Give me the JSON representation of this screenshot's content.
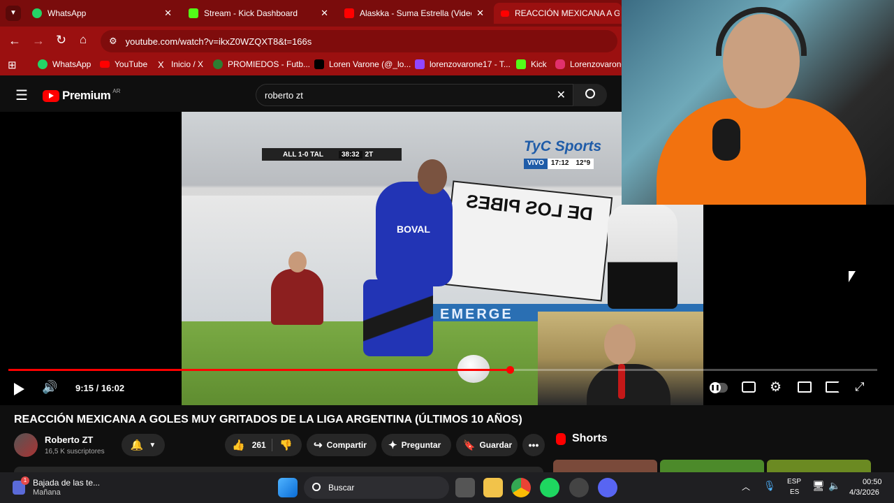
{
  "browser": {
    "tabs": [
      {
        "label": "WhatsApp",
        "color": "#25d366"
      },
      {
        "label": "Stream - Kick Dashboard",
        "color": "#53fc18"
      },
      {
        "label": "Alaskka - Suma Estrella (Video C",
        "color": "#ff0000"
      },
      {
        "label": "REACCIÓN MEXICANA A GO",
        "color": "#ff0000"
      }
    ],
    "url": "youtube.com/watch?v=ikxZ0WZQXT8&t=166s",
    "bookmarks": [
      {
        "label": "WhatsApp",
        "color": "#25d366"
      },
      {
        "label": "YouTube",
        "color": "#ff0000"
      },
      {
        "label": "Inicio / X",
        "color": "#000000"
      },
      {
        "label": "PROMIEDOS - Futb...",
        "color": "#2e7d32"
      },
      {
        "label": "Loren Varone (@_lo...",
        "color": "#000000"
      },
      {
        "label": "lorenzovarone17 - T...",
        "color": "#9146ff"
      },
      {
        "label": "Kick",
        "color": "#53fc18"
      },
      {
        "label": "Lorenzovarone",
        "color": "#e1306c"
      }
    ]
  },
  "youtube": {
    "logo_text": "Premium",
    "region": "AR",
    "search_value": "roberto zt",
    "player": {
      "time": "9:15 / 16:02",
      "progress": 0.577,
      "scoreboard": "ALL 1-0 TAL",
      "clock": "38:32",
      "half": "2T",
      "broadcaster": "TyC Sports",
      "vivo": "VIVO",
      "vivo_time": "17:12",
      "temp": "12°9",
      "banner_text": "DE LOS PIBES",
      "jersey_text": "BOVAL",
      "ad_text": "EMERGE"
    },
    "video_title": "REACCIÓN MEXICANA A GOLES MUY GRITADOS DE LA LIGA ARGENTINA (ÚLTIMOS 10 AÑOS)",
    "channel": {
      "name": "Roberto ZT",
      "subs": "16,5 K suscriptores"
    },
    "actions": {
      "likes": "261",
      "share": "Compartir",
      "ask": "Preguntar",
      "save": "Guardar"
    },
    "shorts_label": "Shorts"
  },
  "taskbar": {
    "widget_title": "Bajada de las te...",
    "widget_sub": "Mañana",
    "widget_badge": "1",
    "search_placeholder": "Buscar",
    "lang_top": "ESP",
    "lang_bottom": "ES",
    "time": "00:50",
    "date": "4/3/2026"
  },
  "colors": {
    "accent_red": "#ff0000",
    "chrome_red": "#9b1010"
  }
}
